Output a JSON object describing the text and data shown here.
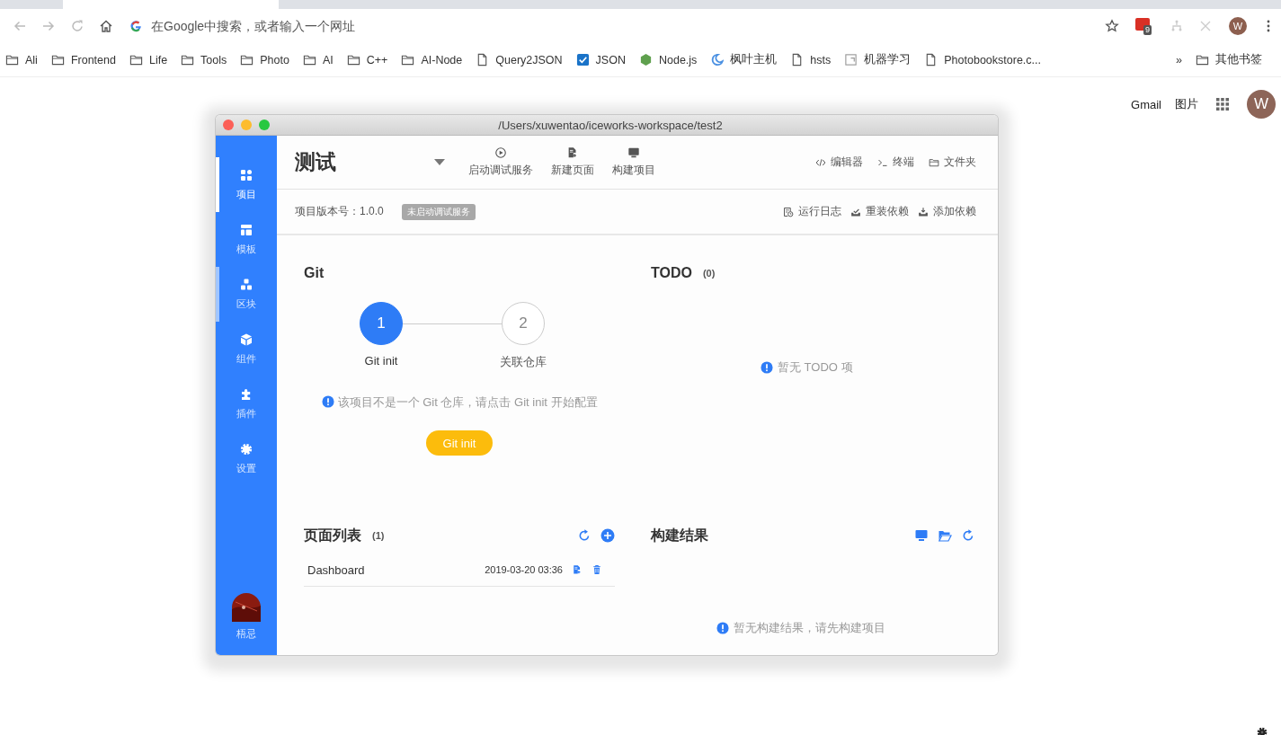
{
  "browser": {
    "omnibox": {
      "placeholder": "在Google中搜索，或者输入一个网址"
    },
    "extension_badge": "9",
    "profile": "W",
    "bookmarks": [
      {
        "label": "Ali",
        "kind": "folder"
      },
      {
        "label": "Frontend",
        "kind": "folder"
      },
      {
        "label": "Life",
        "kind": "folder"
      },
      {
        "label": "Tools",
        "kind": "folder"
      },
      {
        "label": "Photo",
        "kind": "folder"
      },
      {
        "label": "AI",
        "kind": "folder"
      },
      {
        "label": "C++",
        "kind": "folder"
      },
      {
        "label": "AI-Node",
        "kind": "folder"
      },
      {
        "label": "Query2JSON",
        "kind": "page"
      },
      {
        "label": "JSON",
        "kind": "check"
      },
      {
        "label": "Node.js",
        "kind": "hexagon"
      },
      {
        "label": "枫叶主机",
        "kind": "crescent"
      },
      {
        "label": "hsts",
        "kind": "page"
      },
      {
        "label": "机器学习",
        "kind": "bracket"
      },
      {
        "label": "Photobookstore.c...",
        "kind": "page"
      }
    ],
    "overflow": "»",
    "other_bookmarks": "其他书签"
  },
  "google_bar": {
    "links": [
      "Gmail",
      "图片"
    ],
    "avatar": "W"
  },
  "app": {
    "window_title": "/Users/xuwentao/iceworks-workspace/test2",
    "sidebar": {
      "items": [
        {
          "label": "项目",
          "selected": true,
          "hovered": false
        },
        {
          "label": "模板",
          "selected": false,
          "hovered": false
        },
        {
          "label": "区块",
          "selected": false,
          "hovered": true
        },
        {
          "label": "组件",
          "selected": false,
          "hovered": false
        },
        {
          "label": "插件",
          "selected": false,
          "hovered": false
        },
        {
          "label": "设置",
          "selected": false,
          "hovered": false
        }
      ],
      "user": "梧忌"
    },
    "header": {
      "title": "测试",
      "actions": [
        "启动调试服务",
        "新建页面",
        "构建项目"
      ],
      "tools": [
        "编辑器",
        "终端",
        "文件夹"
      ]
    },
    "subheader": {
      "version": "项目版本号：1.0.0",
      "status_badge": "未启动调试服务",
      "actions": [
        "运行日志",
        "重装依赖",
        "添加依赖"
      ]
    },
    "git": {
      "title": "Git",
      "steps": [
        {
          "number": "1",
          "label": "Git init",
          "selected": true
        },
        {
          "number": "2",
          "label": "关联仓库",
          "selected": false
        }
      ],
      "hint": "该项目不是一个 Git 仓库，请点击 Git init 开始配置",
      "button": "Git init"
    },
    "todo": {
      "title": "TODO",
      "count": "(0)",
      "empty": "暂无 TODO 项"
    },
    "pages": {
      "title": "页面列表",
      "count": "(1)",
      "rows": [
        {
          "name": "Dashboard",
          "date": "2019-03-20 03:36"
        }
      ]
    },
    "build": {
      "title": "构建结果",
      "empty": "暂无构建结果，请先构建项目"
    }
  }
}
